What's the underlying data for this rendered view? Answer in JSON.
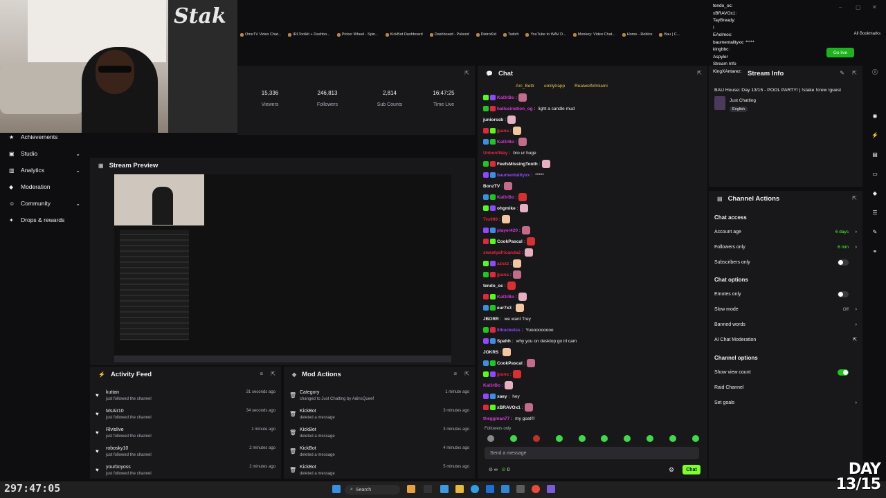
{
  "bookmarks": [
    "OmeTV Video Chat...",
    "IRLToolkit + Dashbo...",
    "Picker Wheel - Spin...",
    "KickBot Dashboard",
    "Dashboard - Pulsoid",
    "DistroKid",
    "Twitch",
    "YouTube to WAV D...",
    "Monkey: Video Chat...",
    "Home - Roblox",
    "Bau | C..."
  ],
  "all_bookmarks": "All Bookmarks",
  "stats": [
    {
      "value": "15,336",
      "label": "Viewers"
    },
    {
      "value": "246,813",
      "label": "Followers"
    },
    {
      "value": "2,814",
      "label": "Sub Counts"
    },
    {
      "value": "16:47:25",
      "label": "Time Live"
    }
  ],
  "sidebar": [
    {
      "label": "Achievements",
      "chev": false
    },
    {
      "label": "Studio",
      "chev": true
    },
    {
      "label": "Analytics",
      "chev": true
    },
    {
      "label": "Moderation",
      "chev": false
    },
    {
      "label": "Community",
      "chev": true
    },
    {
      "label": "Drops & rewards",
      "chev": false
    }
  ],
  "preview": {
    "title": "Stream Preview"
  },
  "activity": {
    "title": "Activity Feed",
    "items": [
      {
        "name": "kuttan",
        "action": "just followed the channel",
        "time": "31 seconds ago"
      },
      {
        "name": "MsAir10",
        "action": "just followed the channel",
        "time": "34 seconds ago"
      },
      {
        "name": "Rlvislive",
        "action": "just followed the channel",
        "time": "1 minute ago"
      },
      {
        "name": "robosky10",
        "action": "just followed the channel",
        "time": "2 minutes ago"
      },
      {
        "name": "yourboyoss",
        "action": "just followed the channel",
        "time": "2 minutes ago"
      }
    ]
  },
  "mod": {
    "title": "Mod Actions",
    "items": [
      {
        "name": "Category",
        "action": "changed to Just Chatting by AdinsQueef",
        "time": "1 minute ago"
      },
      {
        "name": "KickBot",
        "action": "deleted a message",
        "time": "3 minutes ago"
      },
      {
        "name": "KickBot",
        "action": "deleted a message",
        "time": "3 minutes ago"
      },
      {
        "name": "KickBot",
        "action": "deleted a message",
        "time": "4 minutes ago"
      },
      {
        "name": "KickBot",
        "action": "deleted a message",
        "time": "5 minutes ago"
      }
    ]
  },
  "chat": {
    "title": "Chat",
    "top_users": [
      "Arc_Bettr",
      "emilytrapp",
      "Realwolfofmiami"
    ],
    "messages": [
      {
        "user": "KaI3rBo",
        "color": "#d63ad6",
        "text": ""
      },
      {
        "user": "hallucination_og",
        "color": "#d63ad6",
        "text": "light a candle mud"
      },
      {
        "user": "juniorssb",
        "color": "#efeff1",
        "text": ""
      },
      {
        "user": "jpana",
        "color": "#e0283a",
        "text": ""
      },
      {
        "user": "KaI3rBo",
        "color": "#d63ad6",
        "text": ""
      },
      {
        "user": "UnbentWay",
        "color": "#e0283a",
        "text": "bro ur huge"
      },
      {
        "user": "FeefsMissingTooth",
        "color": "#efeff1",
        "text": ""
      },
      {
        "user": "baumentalityxx",
        "color": "#9147ff",
        "text": "*****"
      },
      {
        "user": "BonzTV",
        "color": "#efeff1",
        "text": ""
      },
      {
        "user": "KaI3rBo",
        "color": "#d63ad6",
        "text": ""
      },
      {
        "user": "ohgmike",
        "color": "#efeff1",
        "text": ""
      },
      {
        "user": "Tru999",
        "color": "#e0283a",
        "text": ""
      },
      {
        "user": "player420",
        "color": "#d63ad6",
        "text": ""
      },
      {
        "user": "CookPascal",
        "color": "#efeff1",
        "text": ""
      },
      {
        "user": "sweatyafricanda2",
        "color": "#e0283a",
        "text": ""
      },
      {
        "user": "azozz",
        "color": "#e0283a",
        "text": ""
      },
      {
        "user": "jpana",
        "color": "#e0283a",
        "text": ""
      },
      {
        "user": "tendo_oc",
        "color": "#efeff1",
        "text": ""
      },
      {
        "user": "KaI3rBo",
        "color": "#d63ad6",
        "text": ""
      },
      {
        "user": "eur7x3",
        "color": "#efeff1",
        "text": ""
      },
      {
        "user": "JBORR",
        "color": "#efeff1",
        "text": "we want Trey"
      },
      {
        "user": "lilbucketss",
        "color": "#9147ff",
        "text": "Yuooooooooo"
      },
      {
        "user": "Spahh",
        "color": "#efeff1",
        "text": "why you on desktop go irl cam"
      },
      {
        "user": "JOKRS",
        "color": "#efeff1",
        "text": ""
      },
      {
        "user": "CookPascal",
        "color": "#efeff1",
        "text": ""
      },
      {
        "user": "jpana",
        "color": "#e0283a",
        "text": ""
      },
      {
        "user": "KaI3rBo",
        "color": "#d63ad6",
        "text": ""
      },
      {
        "user": "xaey",
        "color": "#efeff1",
        "text": "hey"
      },
      {
        "user": "xBRAVOx1",
        "color": "#efeff1",
        "text": ""
      },
      {
        "user": "theggman77",
        "color": "#d63ad6",
        "text": "my goat!!!"
      }
    ],
    "followers_only": "Followers only",
    "placeholder": "Send a message",
    "points": "0",
    "send": "Chat"
  },
  "stream_info": {
    "title": "Stream Info",
    "stream_title": "BAU House: Day 13/15 - POOL PARTY! | !stake !crew !guest",
    "category": "Just Chatting",
    "language": "English"
  },
  "actions": {
    "title": "Channel Actions",
    "chat_access": "Chat access",
    "account_age": "Account age",
    "account_age_val": "6 days",
    "followers_only": "Followers only",
    "followers_only_val": "6 min",
    "subscribers_only": "Subscribers only",
    "chat_options": "Chat options",
    "emotes_only": "Emotes only",
    "slow_mode": "Slow mode",
    "slow_mode_val": "Off",
    "banned_words": "Banned words",
    "ai_mod": "AI Chat Moderation",
    "channel_options": "Channel options",
    "show_view_count": "Show view count",
    "raid": "Raid Channel",
    "goals": "Set goals"
  },
  "overlay_chat": [
    "tendo_oc:",
    "xBRAVOx1:",
    "TayBready:",
    "!",
    "EAolmos:",
    "baumentalityxx: *****",
    "kingbbc:",
    "Aspyler",
    "Stream Info",
    "KingXAntarez:"
  ],
  "go_live": "Go live",
  "taskbar": {
    "search": "Search"
  },
  "timer": "297:47:05",
  "day_overlay": [
    "DAY",
    "13/15"
  ],
  "colors": {
    "accent": "#53fc18",
    "panel": "#18181b",
    "bg": "#0e0e10"
  }
}
